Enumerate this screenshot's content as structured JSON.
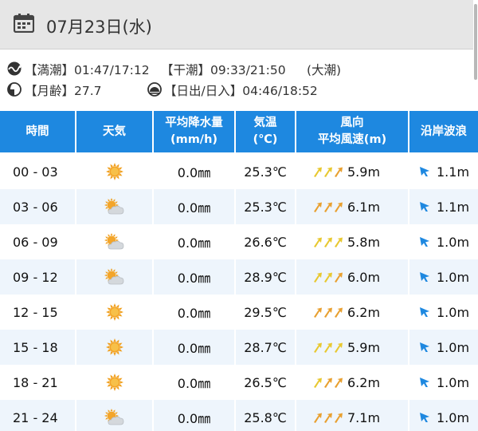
{
  "header": {
    "date": "07月23日(水)",
    "icon": "calendar-icon"
  },
  "tide": {
    "icon": "tide-wave-icon",
    "high_text": "【満潮】01:47/17:12",
    "low_text": "【干潮】09:33/21:50",
    "tide_type": "(大潮)"
  },
  "moon": {
    "icon": "moon-icon",
    "text": "【月齢】27.7"
  },
  "sun": {
    "icon": "sunrise-icon",
    "text": "【日出/日入】04:46/18:52"
  },
  "table": {
    "headers": {
      "time": "時間",
      "weather": "天気",
      "precip_l1": "平均降水量",
      "precip_l2": "(mm/h)",
      "temp_l1": "気温",
      "temp_l2": "(℃)",
      "wind_l1": "風向",
      "wind_l2": "平均風速(m)",
      "wave": "沿岸波浪"
    },
    "rows": [
      {
        "time": "00 - 03",
        "weather": "sunny-icon",
        "precip": "0.0㎜",
        "temp": "25.3℃",
        "wind_colors": [
          "#e8c830",
          "#e8c830",
          "#e8a030"
        ],
        "wind": "5.9m",
        "wave": "1.1m"
      },
      {
        "time": "03 - 06",
        "weather": "partly-cloudy-icon",
        "precip": "0.0㎜",
        "temp": "25.3℃",
        "wind_colors": [
          "#e8a030",
          "#e8a030",
          "#e8a030"
        ],
        "wind": "6.1m",
        "wave": "1.1m"
      },
      {
        "time": "06 - 09",
        "weather": "partly-cloudy-icon",
        "precip": "0.0㎜",
        "temp": "26.6℃",
        "wind_colors": [
          "#e8c830",
          "#e8c830",
          "#e8c830"
        ],
        "wind": "5.8m",
        "wave": "1.0m"
      },
      {
        "time": "09 - 12",
        "weather": "partly-cloudy-icon",
        "precip": "0.0㎜",
        "temp": "28.9℃",
        "wind_colors": [
          "#e8c830",
          "#e8c830",
          "#e8a030"
        ],
        "wind": "6.0m",
        "wave": "1.0m"
      },
      {
        "time": "12 - 15",
        "weather": "sunny-icon",
        "precip": "0.0㎜",
        "temp": "29.5℃",
        "wind_colors": [
          "#e8a030",
          "#e8a030",
          "#e8a030"
        ],
        "wind": "6.2m",
        "wave": "1.0m"
      },
      {
        "time": "15 - 18",
        "weather": "sunny-icon",
        "precip": "0.0㎜",
        "temp": "28.7℃",
        "wind_colors": [
          "#e8c830",
          "#e8c830",
          "#e8c830"
        ],
        "wind": "5.9m",
        "wave": "1.0m"
      },
      {
        "time": "18 - 21",
        "weather": "sunny-icon",
        "precip": "0.0㎜",
        "temp": "26.5℃",
        "wind_colors": [
          "#e8c830",
          "#e8a030",
          "#e8a030"
        ],
        "wind": "6.2m",
        "wave": "1.0m"
      },
      {
        "time": "21 - 24",
        "weather": "partly-cloudy-icon",
        "precip": "0.0㎜",
        "temp": "25.8℃",
        "wind_colors": [
          "#e8a030",
          "#e8a030",
          "#e8a030"
        ],
        "wind": "7.1m",
        "wave": "1.0m"
      }
    ]
  },
  "colors": {
    "header_blue": "#1e88e0",
    "row_alt": "#eef5fc",
    "wave_arrow": "#1e88e0"
  }
}
